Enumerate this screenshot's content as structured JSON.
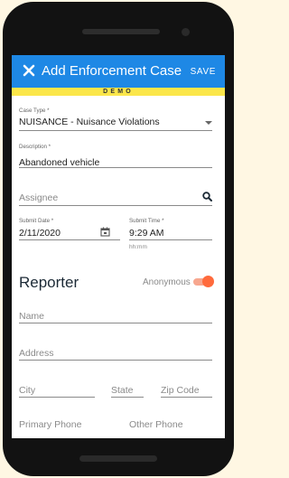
{
  "appbar": {
    "title": "Add Enforcement Case",
    "save_label": "SAVE",
    "close_icon": "close-icon",
    "color": "#1e88e5"
  },
  "banner": {
    "text": "DEMO",
    "color": "#fbe64a"
  },
  "form": {
    "case_type": {
      "label": "Case Type *",
      "value": "NUISANCE - Nuisance Violations"
    },
    "description": {
      "label": "Description *",
      "value": "Abandoned  vehicle"
    },
    "assignee": {
      "placeholder": "Assignee",
      "icon": "search-icon"
    },
    "submit_date": {
      "label": "Submit Date *",
      "value": "2/11/2020",
      "icon": "calendar-icon"
    },
    "submit_time": {
      "label": "Submit Time *",
      "value": "9:29 AM",
      "hint": "hh:mm"
    }
  },
  "reporter": {
    "heading": "Reporter",
    "anonymous_label": "Anonymous",
    "anonymous_on": true,
    "toggle_color": "#ff6a3c",
    "fields": {
      "name": "Name",
      "address": "Address",
      "city": "City",
      "state": "State",
      "zip": "Zip Code",
      "primary_phone": "Primary Phone",
      "other_phone": "Other Phone"
    }
  }
}
